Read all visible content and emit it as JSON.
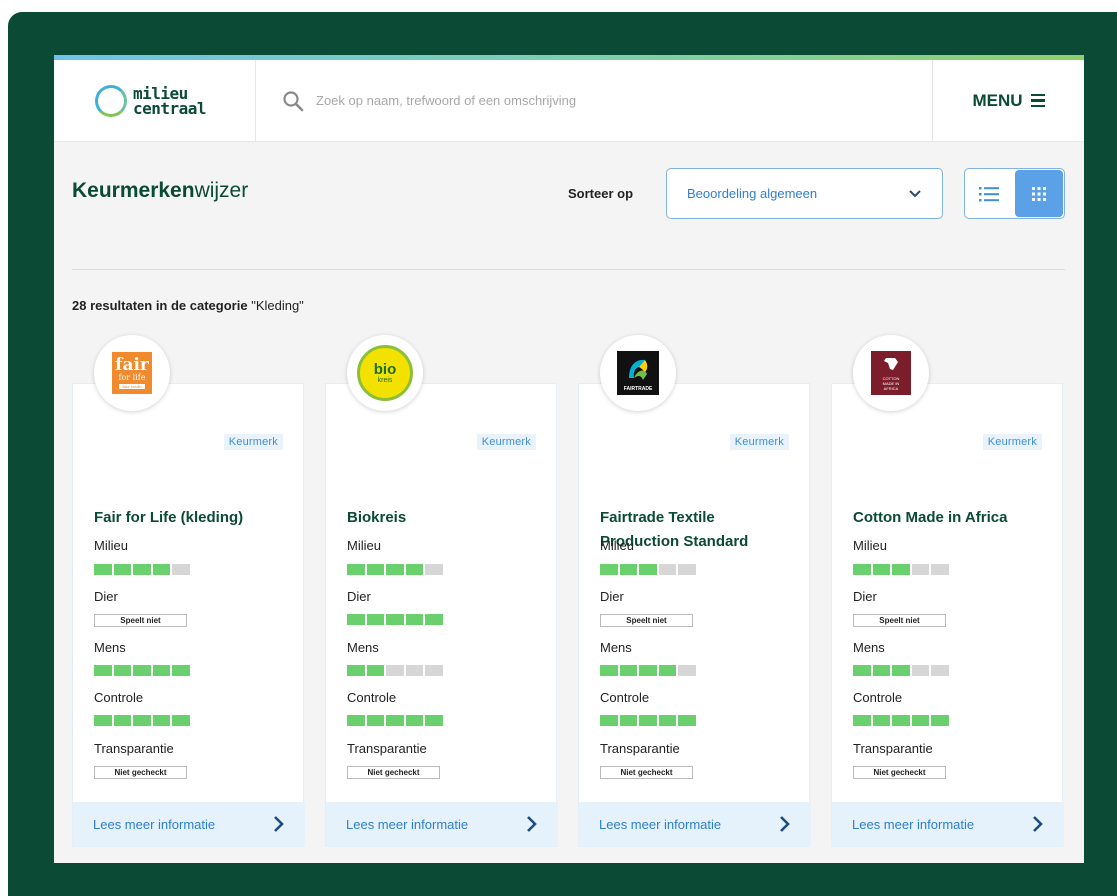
{
  "header": {
    "logo_line1": "milieu",
    "logo_line2": "centraal",
    "search_placeholder": "Zoek op naam, trefwoord of een omschrijving",
    "menu_label": "MENU"
  },
  "toolbar": {
    "title_bold": "Keurmerken",
    "title_light": "wijzer",
    "sort_label": "Sorteer op",
    "sort_value": "Beoordeling algemeen",
    "active_view": "grid"
  },
  "results": {
    "count_text": "28 resultaten in de categorie",
    "category": "\"Kleding\""
  },
  "criteria_labels": {
    "milieu": "Milieu",
    "dier": "Dier",
    "mens": "Mens",
    "controle": "Controle",
    "transparantie": "Transparantie"
  },
  "colors": {
    "brand_green": "#0b4a34",
    "link_blue": "#2f7fd1",
    "score_on": "#6ad06d",
    "score_off": "#d6d6d6"
  },
  "cards": [
    {
      "logo": "fair-for-life-logo",
      "logo_text": [
        "fair",
        "for life",
        "fair trade"
      ],
      "badge": "Keurmerk",
      "title": "Fair for Life (kleding)",
      "milieu": 4,
      "dier": "Speelt niet",
      "mens": 5,
      "controle": 5,
      "transparantie": "Niet gecheckt",
      "more": "Lees meer informatie"
    },
    {
      "logo": "biokreis-logo",
      "logo_text": [
        "bio",
        "kreis"
      ],
      "badge": "Keurmerk",
      "title": "Biokreis",
      "milieu": 4,
      "dier": 5,
      "mens": 2,
      "controle": 5,
      "transparantie": "Niet gecheckt",
      "more": "Lees meer informatie"
    },
    {
      "logo": "fairtrade-logo",
      "logo_text": [
        "FAIRTRADE"
      ],
      "badge": "Keurmerk",
      "title": "Fairtrade Textile Production Standard",
      "milieu": 3,
      "dier": "Speelt niet",
      "mens": 4,
      "controle": 5,
      "transparantie": "Niet gecheckt",
      "more": "Lees meer informatie"
    },
    {
      "logo": "cotton-made-in-africa-logo",
      "logo_text": [
        "COTTON",
        "MADE IN",
        "AFRICA"
      ],
      "badge": "Keurmerk",
      "title": "Cotton Made in Africa",
      "milieu": 3,
      "dier": "Speelt niet",
      "mens": 3,
      "controle": 5,
      "transparantie": "Niet gecheckt",
      "more": "Lees meer informatie"
    }
  ]
}
